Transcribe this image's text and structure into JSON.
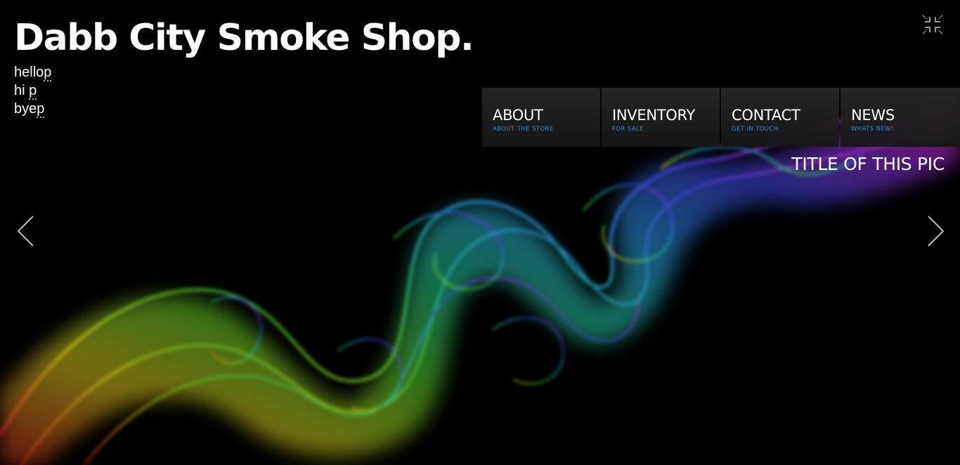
{
  "header": {
    "site_title": "Dabb City Smoke Shop."
  },
  "notes": {
    "lines": [
      {
        "word": "hello",
        "mark": "p"
      },
      {
        "word": "hi ",
        "mark": "p"
      },
      {
        "word": "bye",
        "mark": "p"
      }
    ]
  },
  "nav": {
    "items": [
      {
        "label": "ABOUT",
        "sub": "ABOUT THE STORE"
      },
      {
        "label": "INVENTORY",
        "sub": "FOR SALE"
      },
      {
        "label": "CONTACT",
        "sub": "GET IN TOUCH"
      },
      {
        "label": "NEWS",
        "sub": "WHATS NEW!"
      }
    ]
  },
  "slideshow": {
    "caption": "TITLE OF THIS PIC",
    "prev_icon": "chevron-left-icon",
    "next_icon": "chevron-right-icon",
    "fullscreen_icon": "collapse-fullscreen-icon"
  },
  "colors": {
    "background": "#000000",
    "nav_sub_text": "#3a86c8",
    "nav_bg": "#1e1e1e"
  }
}
